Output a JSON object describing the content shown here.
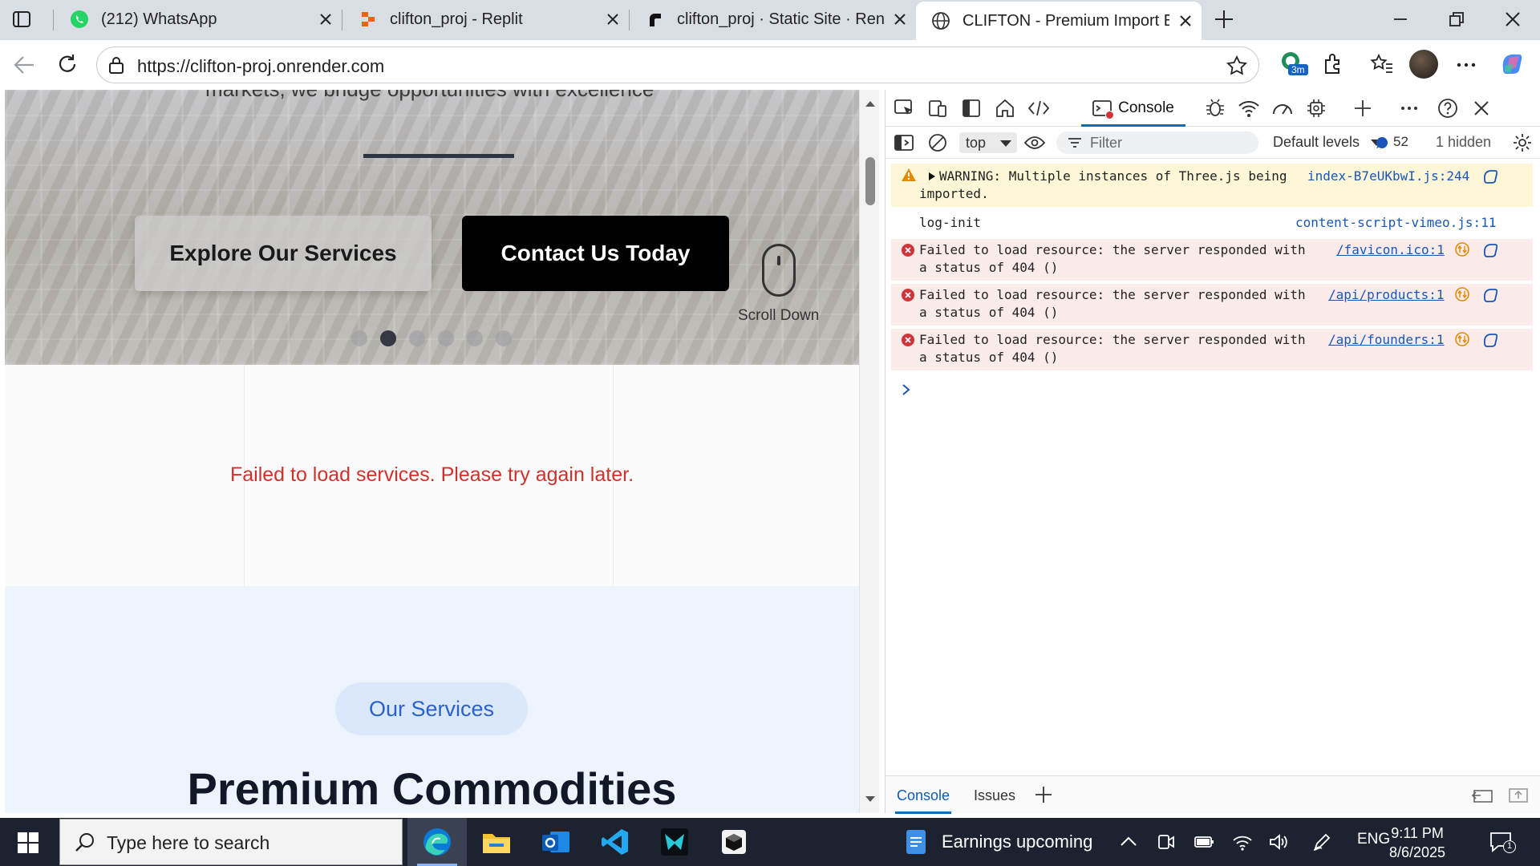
{
  "browser": {
    "tabs": [
      {
        "title": "(212) WhatsApp",
        "active": false,
        "icon": "whatsapp-icon"
      },
      {
        "title": "clifton_proj - Replit",
        "active": false,
        "icon": "replit-icon"
      },
      {
        "title": "clifton_proj · Static Site · Render",
        "active": false,
        "icon": "render-icon"
      },
      {
        "title": "CLIFTON - Premium Import Expor",
        "active": true,
        "icon": "globe-icon"
      }
    ],
    "url": "https://clifton-proj.onrender.com",
    "extension_badge": "3m"
  },
  "page": {
    "hero_text": "markets, we bridge opportunities with excellence",
    "explore_button": "Explore Our Services",
    "contact_button": "Contact Us Today",
    "scroll_label": "Scroll Down",
    "carousel": {
      "count": 6,
      "active_index": 1
    },
    "error_message": "Failed to load services. Please try again later.",
    "services_pill": "Our Services",
    "services_heading": "Premium Commodities"
  },
  "devtools": {
    "active_tab": "Console",
    "context": "top",
    "filter_placeholder": "Filter",
    "levels": "Default levels",
    "message_count": "52",
    "hidden": "1 hidden",
    "messages": [
      {
        "level": "warning",
        "text_line1": "WARNING: Multiple instances of Three.js being",
        "text_line2": "imported.",
        "source": "index-B7eUKbwI.js:244"
      },
      {
        "level": "info",
        "text_line1": "log-init",
        "text_line2": "",
        "source": "content-script-vimeo.js:11"
      },
      {
        "level": "error",
        "text_line1": "Failed to load resource: the server responded with",
        "text_line2": "a status of 404 ()",
        "source": "/favicon.ico:1"
      },
      {
        "level": "error",
        "text_line1": "Failed to load resource: the server responded with",
        "text_line2": "a status of 404 ()",
        "source": "/api/products:1"
      },
      {
        "level": "error",
        "text_line1": "Failed to load resource: the server responded with",
        "text_line2": "a status of 404 ()",
        "source": "/api/founders:1"
      }
    ],
    "bottom_tabs": [
      "Console",
      "Issues"
    ]
  },
  "taskbar": {
    "search_placeholder": "Type here to search",
    "news": "Earnings upcoming",
    "language": "ENG",
    "time": "9:11 PM",
    "date": "8/6/2025",
    "notification_count": "1"
  },
  "colors": {
    "accent": "#0f6cbd",
    "error_text": "#d0312d",
    "pill_text": "#2b62c9",
    "taskbar": "#1c2230"
  }
}
